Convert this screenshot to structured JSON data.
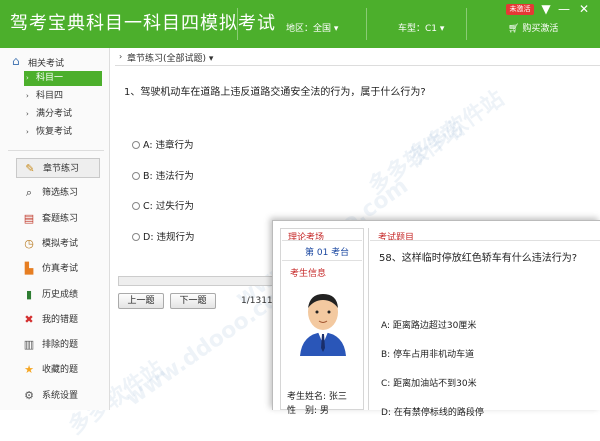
{
  "app": {
    "title": "驾考宝典科目一科目四模拟考试",
    "region_label": "地区：全国",
    "cartype_label": "车型：C1",
    "buy_label": "购买激活",
    "badge": "未激活",
    "menu_glyph": "▼",
    "minimize_glyph": "—",
    "close_glyph": "✕"
  },
  "sidebar": {
    "header": "相关考试",
    "tree": [
      {
        "label": "科目一",
        "selected": true
      },
      {
        "label": "科目四",
        "selected": false
      },
      {
        "label": "满分考试",
        "selected": false
      },
      {
        "label": "恢复考试",
        "selected": false
      }
    ],
    "nav": [
      {
        "label": "章节练习",
        "icon": "pencil-icon",
        "glyph": "✎",
        "color": "#c88a1a",
        "active": true
      },
      {
        "label": "筛选练习",
        "icon": "search-icon",
        "glyph": "⌕",
        "color": "#333",
        "active": false
      },
      {
        "label": "套题练习",
        "icon": "book-icon",
        "glyph": "▤",
        "color": "#c0392b",
        "active": false
      },
      {
        "label": "模拟考试",
        "icon": "clock-icon",
        "glyph": "◷",
        "color": "#b7791f",
        "active": false
      },
      {
        "label": "仿真考试",
        "icon": "car-icon",
        "glyph": "▙",
        "color": "#e67e22",
        "active": false
      },
      {
        "label": "历史成绩",
        "icon": "bar-chart-icon",
        "glyph": "▮",
        "color": "#2e7d32",
        "active": false
      },
      {
        "label": "我的错题",
        "icon": "cross-icon",
        "glyph": "✖",
        "color": "#d32f2f",
        "active": false
      },
      {
        "label": "排除的题",
        "icon": "trash-icon",
        "glyph": "▥",
        "color": "#555",
        "active": false
      },
      {
        "label": "收藏的题",
        "icon": "star-icon",
        "glyph": "★",
        "color": "#f5a623",
        "active": false
      },
      {
        "label": "系统设置",
        "icon": "gear-icon",
        "glyph": "⚙",
        "color": "#555",
        "active": false
      }
    ]
  },
  "main": {
    "breadcrumb": "章节练习(全部试题)",
    "question": "1、驾驶机动车在道路上违反道路交通安全法的行为，属于什么行为?",
    "options": [
      "A: 违章行为",
      "B: 违法行为",
      "C: 过失行为",
      "D: 违规行为"
    ],
    "prev_label": "上一题",
    "next_label": "下一题",
    "page_count": "1/1311"
  },
  "exam_window": {
    "venue_title": "理论考场",
    "seat": "第 01 考台",
    "info_title": "考生信息",
    "name_label": "考生姓名: 张三",
    "extra_label": "性　别: 男",
    "question_title": "考试题目",
    "question": "58、这样临时停放红色轿车有什么违法行为?",
    "options": [
      "A: 距离路边超过30厘米",
      "B: 停车占用非机动车道",
      "C: 距离加油站不到30米",
      "D: 在有禁停标线的路段停"
    ]
  },
  "watermarks": [
    "多多软件站",
    "www.ddooo.com",
    "多多软件站",
    "www.ddooo.com",
    "多多软件站"
  ]
}
